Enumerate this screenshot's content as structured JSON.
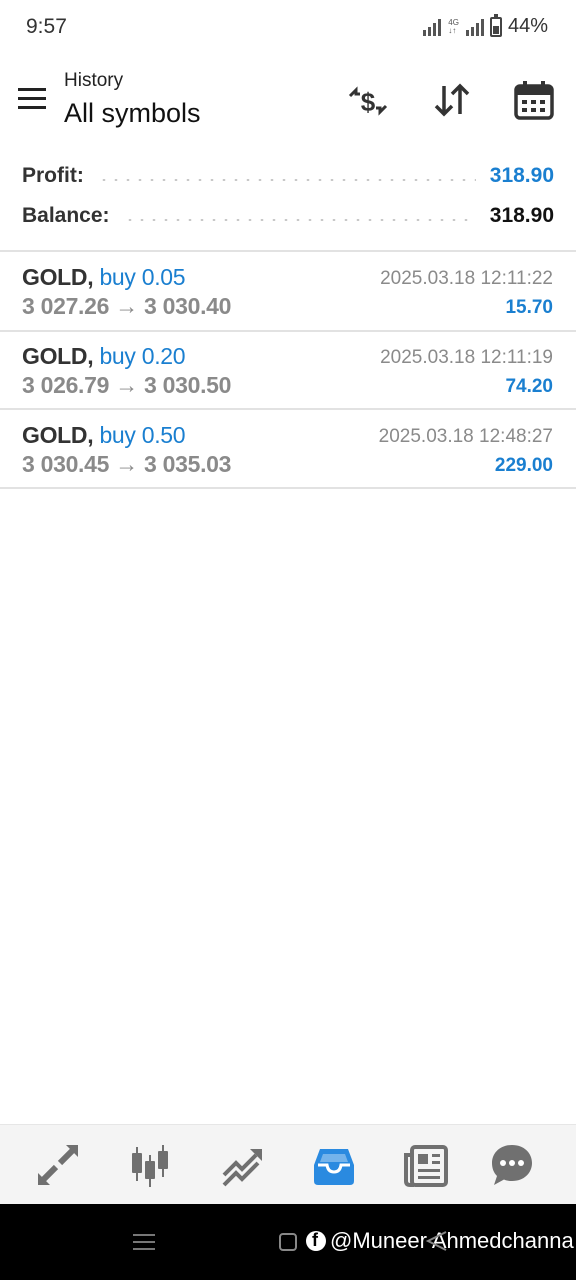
{
  "status_bar": {
    "time": "9:57",
    "network": "4G",
    "battery": "44%"
  },
  "header": {
    "subtitle": "History",
    "title": "All symbols",
    "icons": [
      "menu-icon",
      "dollar-exchange-icon",
      "sort-icon",
      "calendar-icon"
    ]
  },
  "summary": {
    "profit_label": "Profit:",
    "profit_value": "318.90",
    "balance_label": "Balance:",
    "balance_value": "318.90"
  },
  "deals": [
    {
      "symbol": "GOLD,",
      "side": "buy 0.05",
      "prices": "3 027.26 → 3 030.40",
      "time": "2025.03.18 12:11:22",
      "profit": "15.70"
    },
    {
      "symbol": "GOLD,",
      "side": "buy 0.20",
      "prices": "3 026.79 → 3 030.50",
      "time": "2025.03.18 12:11:19",
      "profit": "74.20"
    },
    {
      "symbol": "GOLD,",
      "side": "buy 0.50",
      "prices": "3 030.45 → 3 035.03",
      "time": "2025.03.18 12:48:27",
      "profit": "229.00"
    }
  ],
  "tabbar": {
    "tabs": [
      "quotes-tab-icon",
      "chart-tab-icon",
      "trade-tab-icon",
      "history-tab-icon",
      "news-tab-icon",
      "messages-tab-icon"
    ],
    "active": "history-tab-icon"
  },
  "watermark": "@Muneer Ahmedchanna",
  "colors": {
    "accent": "#1a7fd0",
    "muted": "#8a8a8a",
    "active_tab": "#2a8ae0",
    "inactive_tab": "#707070"
  }
}
